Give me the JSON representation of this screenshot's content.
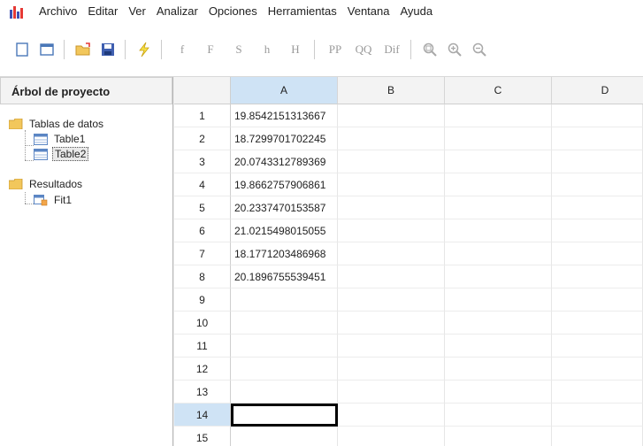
{
  "menu": {
    "items": [
      "Archivo",
      "Editar",
      "Ver",
      "Analizar",
      "Opciones",
      "Herramientas",
      "Ventana",
      "Ayuda"
    ]
  },
  "toolbar": {
    "icons": [
      "new-document-icon",
      "window-icon",
      "open-folder-icon",
      "save-disk-icon",
      "lightning-icon"
    ],
    "text_buttons": [
      "f",
      "F",
      "S",
      "h",
      "H",
      "PP",
      "QQ",
      "Dif"
    ],
    "zoom_icons": [
      "zoom-fit-icon",
      "zoom-in-icon",
      "zoom-out-icon"
    ]
  },
  "tree": {
    "header": "Árbol de proyecto",
    "nodes": [
      {
        "label": "Tablas de datos",
        "kind": "folder",
        "level": 0
      },
      {
        "label": "Table1",
        "kind": "table",
        "level": 1
      },
      {
        "label": "Table2",
        "kind": "table",
        "level": 1,
        "selected": true
      },
      {
        "label": "Resultados",
        "kind": "folder",
        "level": 0
      },
      {
        "label": "Fit1",
        "kind": "fit",
        "level": 1
      }
    ]
  },
  "grid": {
    "columns": [
      "A",
      "B",
      "C",
      "D"
    ],
    "active_column": "A",
    "active_row": "14",
    "rows": [
      {
        "num": "1",
        "A": "19.8542151313667"
      },
      {
        "num": "2",
        "A": "18.7299701702245"
      },
      {
        "num": "3",
        "A": "20.0743312789369"
      },
      {
        "num": "4",
        "A": "19.8662757906861"
      },
      {
        "num": "5",
        "A": "20.2337470153587"
      },
      {
        "num": "6",
        "A": "21.0215498015055"
      },
      {
        "num": "7",
        "A": "18.1771203486968"
      },
      {
        "num": "8",
        "A": "20.1896755539451"
      },
      {
        "num": "9",
        "A": ""
      },
      {
        "num": "10",
        "A": ""
      },
      {
        "num": "11",
        "A": ""
      },
      {
        "num": "12",
        "A": ""
      },
      {
        "num": "13",
        "A": ""
      },
      {
        "num": "14",
        "A": ""
      },
      {
        "num": "15",
        "A": ""
      }
    ]
  },
  "colors": {
    "header_active": "#cfe3f5",
    "folder": "#f2c75c",
    "table_blue": "#5b86c4"
  }
}
